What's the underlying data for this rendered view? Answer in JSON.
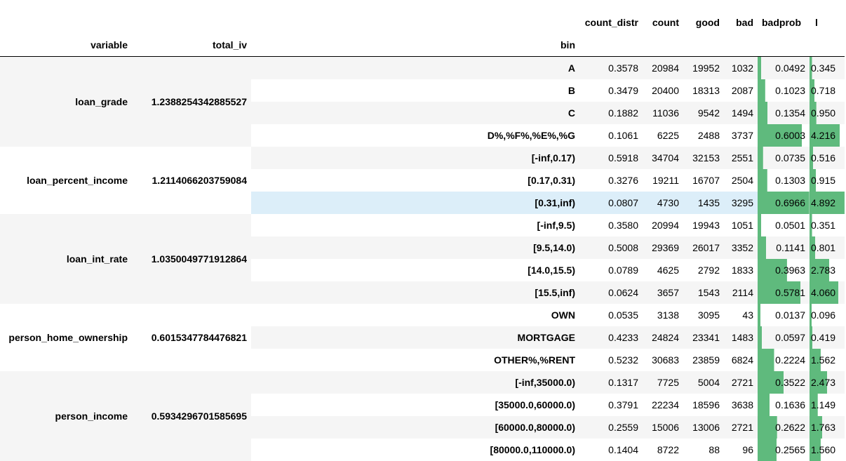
{
  "headers": {
    "count_distr": "count_distr",
    "count": "count",
    "good": "good",
    "bad": "bad",
    "badprob": "badprob",
    "woe_partial": "l",
    "variable": "variable",
    "total_iv": "total_iv",
    "bin": "bin"
  },
  "colors": {
    "bar": "#5fba7d",
    "row_alt": "#f5f5f5",
    "row_highlight": "#dceef9"
  },
  "groups": [
    {
      "variable": "loan_grade",
      "total_iv": "1.2388254342885527"
    },
    {
      "variable": "loan_percent_income",
      "total_iv": "1.2114066203759084"
    },
    {
      "variable": "loan_int_rate",
      "total_iv": "1.0350049771912864"
    },
    {
      "variable": "person_home_ownership",
      "total_iv": "0.6015347784476821"
    },
    {
      "variable": "person_income",
      "total_iv": "0.5934296701585695"
    }
  ],
  "rows": [
    {
      "bin": "A",
      "count_distr": "0.3578",
      "count": "20984",
      "good": "19952",
      "bad": "1032",
      "badprob": "0.0492",
      "badprob_value": 0.0492,
      "woe": "0.345",
      "woe_value": 0.345
    },
    {
      "bin": "B",
      "count_distr": "0.3479",
      "count": "20400",
      "good": "18313",
      "bad": "2087",
      "badprob": "0.1023",
      "badprob_value": 0.1023,
      "woe": "0.718",
      "woe_value": 0.718
    },
    {
      "bin": "C",
      "count_distr": "0.1882",
      "count": "11036",
      "good": "9542",
      "bad": "1494",
      "badprob": "0.1354",
      "badprob_value": 0.1354,
      "woe": "0.950",
      "woe_value": 0.95
    },
    {
      "bin": "D%,%F%,%E%,%G",
      "count_distr": "0.1061",
      "count": "6225",
      "good": "2488",
      "bad": "3737",
      "badprob": "0.6003",
      "badprob_value": 0.6003,
      "woe": "4.216",
      "woe_value": 4.216
    },
    {
      "bin": "[-inf,0.17)",
      "count_distr": "0.5918",
      "count": "34704",
      "good": "32153",
      "bad": "2551",
      "badprob": "0.0735",
      "badprob_value": 0.0735,
      "woe": "0.516",
      "woe_value": 0.516
    },
    {
      "bin": "[0.17,0.31)",
      "count_distr": "0.3276",
      "count": "19211",
      "good": "16707",
      "bad": "2504",
      "badprob": "0.1303",
      "badprob_value": 0.1303,
      "woe": "0.915",
      "woe_value": 0.915
    },
    {
      "bin": "[0.31,inf)",
      "count_distr": "0.0807",
      "count": "4730",
      "good": "1435",
      "bad": "3295",
      "badprob": "0.6966",
      "badprob_value": 0.6966,
      "woe": "4.892",
      "woe_value": 4.892
    },
    {
      "bin": "[-inf,9.5)",
      "count_distr": "0.3580",
      "count": "20994",
      "good": "19943",
      "bad": "1051",
      "badprob": "0.0501",
      "badprob_value": 0.0501,
      "woe": "0.351",
      "woe_value": 0.351
    },
    {
      "bin": "[9.5,14.0)",
      "count_distr": "0.5008",
      "count": "29369",
      "good": "26017",
      "bad": "3352",
      "badprob": "0.1141",
      "badprob_value": 0.1141,
      "woe": "0.801",
      "woe_value": 0.801
    },
    {
      "bin": "[14.0,15.5)",
      "count_distr": "0.0789",
      "count": "4625",
      "good": "2792",
      "bad": "1833",
      "badprob": "0.3963",
      "badprob_value": 0.3963,
      "woe": "2.783",
      "woe_value": 2.783
    },
    {
      "bin": "[15.5,inf)",
      "count_distr": "0.0624",
      "count": "3657",
      "good": "1543",
      "bad": "2114",
      "badprob": "0.5781",
      "badprob_value": 0.5781,
      "woe": "4.060",
      "woe_value": 4.06
    },
    {
      "bin": "OWN",
      "count_distr": "0.0535",
      "count": "3138",
      "good": "3095",
      "bad": "43",
      "badprob": "0.0137",
      "badprob_value": 0.0137,
      "woe": "0.096",
      "woe_value": 0.096
    },
    {
      "bin": "MORTGAGE",
      "count_distr": "0.4233",
      "count": "24824",
      "good": "23341",
      "bad": "1483",
      "badprob": "0.0597",
      "badprob_value": 0.0597,
      "woe": "0.419",
      "woe_value": 0.419
    },
    {
      "bin": "OTHER%,%RENT",
      "count_distr": "0.5232",
      "count": "30683",
      "good": "23859",
      "bad": "6824",
      "badprob": "0.2224",
      "badprob_value": 0.2224,
      "woe": "1.562",
      "woe_value": 1.562
    },
    {
      "bin": "[-inf,35000.0)",
      "count_distr": "0.1317",
      "count": "7725",
      "good": "5004",
      "bad": "2721",
      "badprob": "0.3522",
      "badprob_value": 0.3522,
      "woe": "2.473",
      "woe_value": 2.473
    },
    {
      "bin": "[35000.0,60000.0)",
      "count_distr": "0.3791",
      "count": "22234",
      "good": "18596",
      "bad": "3638",
      "badprob": "0.1636",
      "badprob_value": 0.1636,
      "woe": "1.149",
      "woe_value": 1.149
    },
    {
      "bin": "[60000.0,80000.0)",
      "count_distr": "0.2559",
      "count": "15006",
      "good": "13006",
      "bad": "2721",
      "badprob": "0.2622",
      "badprob_value": 0.2622,
      "woe": "1.763",
      "woe_value": 1.763
    },
    {
      "bin": "[80000.0,110000.0)",
      "count_distr": "0.1404",
      "count": "8722",
      "good": "88",
      "bad": "96",
      "badprob": "0.2565",
      "badprob_value": 0.2565,
      "woe": "1.560",
      "woe_value": 1.56
    }
  ]
}
